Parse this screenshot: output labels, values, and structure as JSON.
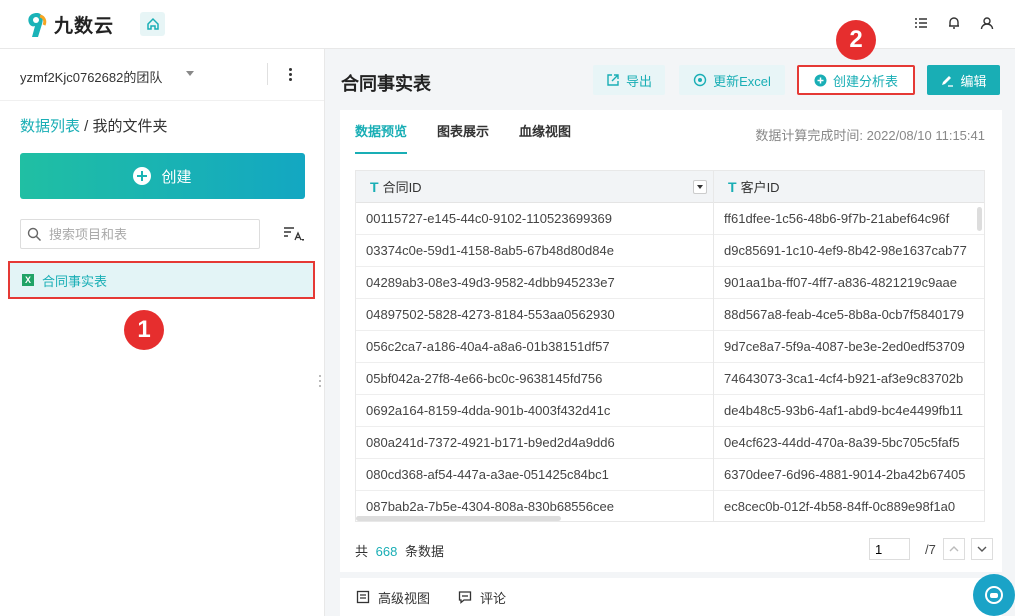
{
  "brand": {
    "name": "九数云",
    "accent": "#19aeb5"
  },
  "sidebar": {
    "team_name": "yzmf2Kjc0762682的团队",
    "breadcrumb_link": "数据列表",
    "breadcrumb_sep": " / ",
    "breadcrumb_current": "我的文件夹",
    "create_label": "创建",
    "search_placeholder": "搜索项目和表",
    "file_item": "合同事实表",
    "marker": "1"
  },
  "main": {
    "title": "合同事实表",
    "toolbar": {
      "export_label": "导出",
      "update_excel_label": "更新Excel",
      "create_analysis_label": "创建分析表",
      "edit_label": "编辑"
    },
    "marker": "2",
    "tabs": [
      "数据预览",
      "图表展示",
      "血缘视图"
    ],
    "calc_time_label": "数据计算完成时间:",
    "calc_time_value": "2022/08/10 11:15:41",
    "columns": [
      {
        "type": "T",
        "name": "合同ID"
      },
      {
        "type": "T",
        "name": "客户ID"
      }
    ],
    "rows": [
      [
        "00115727-e145-44c0-9102-110523699369",
        "ff61dfee-1c56-48b6-9f7b-21abef64c96f"
      ],
      [
        "03374c0e-59d1-4158-8ab5-67b48d80d84e",
        "d9c85691-1c10-4ef9-8b42-98e1637cab77"
      ],
      [
        "04289ab3-08e3-49d3-9582-4dbb945233e7",
        "901aa1ba-ff07-4ff7-a836-4821219c9aae"
      ],
      [
        "04897502-5828-4273-8184-553aa0562930",
        "88d567a8-feab-4ce5-8b8a-0cb7f5840179"
      ],
      [
        "056c2ca7-a186-40a4-a8a6-01b38151df57",
        "9d7ce8a7-5f9a-4087-be3e-2ed0edf53709"
      ],
      [
        "05bf042a-27f8-4e66-bc0c-9638145fd756",
        "74643073-3ca1-4cf4-b921-af3e9c83702b"
      ],
      [
        "0692a164-8159-4dda-901b-4003f432d41c",
        "de4b48c5-93b6-4af1-abd9-bc4e4499fb11"
      ],
      [
        "080a241d-7372-4921-b171-b9ed2d4a9dd6",
        "0e4cf623-44dd-470a-8a39-5bc705c5faf5"
      ],
      [
        "080cd368-af54-447a-a3ae-051425c84bc1",
        "6370dee7-6d96-4881-9014-2ba42b67405"
      ],
      [
        "087bab2a-7b5e-4304-808a-830b68556cee",
        "ec8cec0b-012f-4b58-84ff-0c889e98f1a0"
      ]
    ],
    "total_prefix": "共",
    "total_count": "668",
    "total_suffix": "条数据",
    "page_current": "1",
    "page_total": "/7"
  },
  "bottom": {
    "advanced_view": "高级视图",
    "comments": "评论"
  }
}
